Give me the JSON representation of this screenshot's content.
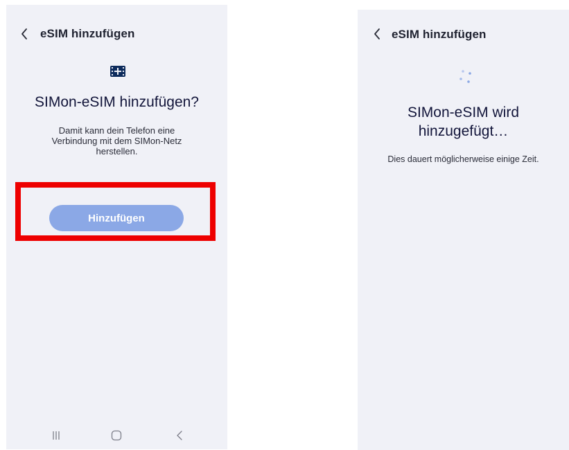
{
  "left_screen": {
    "title": "eSIM hinzufügen",
    "icon": "sim-card-icon",
    "heading": "SIMon-eSIM hinzufügen?",
    "description": "Damit kann dein Telefon eine Verbindung mit dem SIMon-Netz herstellen.",
    "button_label": "Hinzufügen",
    "button_color": "#8ba8e6",
    "highlight_color": "#ee0000",
    "nav": [
      "recent-apps-icon",
      "home-icon",
      "back-icon"
    ]
  },
  "right_screen": {
    "title": "eSIM hinzufügen",
    "icon": "loading-spinner-icon",
    "heading": "SIMon-eSIM wird hinzugefügt…",
    "description": "Dies dauert möglicherweise einige Zeit.",
    "spinner_color": "#8aa7e4"
  },
  "colors": {
    "screen_background": "#f0f1f7",
    "page_background": "#ffffff",
    "text_primary": "#12153a"
  }
}
